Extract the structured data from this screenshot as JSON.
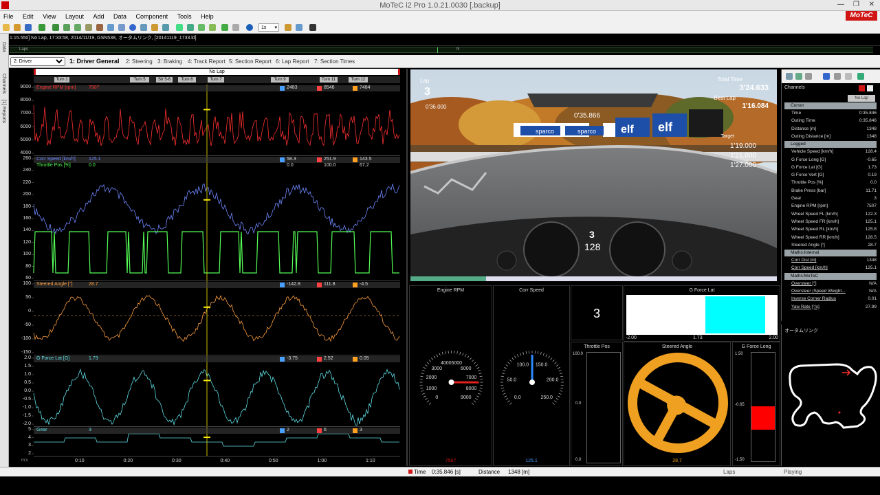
{
  "window": {
    "title": "MoTeC i2 Pro 1.0.21.0030  [.backup]"
  },
  "menu": {
    "items": [
      "File",
      "Edit",
      "View",
      "Layout",
      "Add",
      "Data",
      "Component",
      "Tools",
      "Help"
    ],
    "logo": "MoTeC"
  },
  "toolbar": {
    "zoom_value": "1x"
  },
  "lap_info": {
    "text": "1:15.550] No Lap, 17:33:58, 2014/11/19, GSN538, オータムリンク, [20141119_1733.ld]",
    "laps_label": "Laps",
    "marker": "N"
  },
  "sidebar": {
    "data_label": "Data",
    "channels_label": "Channels",
    "reports_label": "[1] Reports"
  },
  "tabs": {
    "worksheet_select": "2: Driver",
    "items": [
      "1: Driver General",
      "2: Steering",
      "3: Braking",
      "4: Track Report",
      "5: Section Report",
      "6: Lap Report",
      "7: Section Times"
    ],
    "active": 0
  },
  "graph": {
    "lap_label": "No Lap",
    "turns": [
      "Turn 1",
      "Turn 5",
      "Str 5-6",
      "Turn 6",
      "Turn 7",
      "Turn 9",
      "Turn 11",
      "Turn 12"
    ],
    "x_ticks": [
      "0:10",
      "0:20",
      "0:30",
      "0:40",
      "0:50",
      "1:00",
      "1:10"
    ],
    "x_unit": "m:s",
    "panes": [
      {
        "channels": [
          {
            "name": "Engine RPM [rpm]",
            "value": "7507",
            "color": "#ff3030"
          }
        ],
        "min": "2483",
        "max": "8546",
        "delta": "7484",
        "y_ticks": [
          "9000",
          "8000",
          "7000",
          "6000",
          "5000",
          "4000"
        ]
      },
      {
        "channels": [
          {
            "name": "Corr Speed [km/h]",
            "value": "125.1",
            "color": "#6f88ff"
          },
          {
            "name": "Throttle Pos [%]",
            "value": "0.0",
            "color": "#55ff55"
          }
        ],
        "min": "58.3",
        "max": "251.9",
        "delta": "143.5",
        "min2": "0.0",
        "max2": "100.0",
        "delta2": "67.2",
        "y_ticks": [
          "260",
          "240",
          "220",
          "200",
          "180",
          "160",
          "140",
          "120",
          "100",
          "80",
          "60"
        ]
      },
      {
        "channels": [
          {
            "name": "Steered Angle [°]",
            "value": "28.7",
            "color": "#ffa040"
          }
        ],
        "min": "-142.8",
        "max": "111.8",
        "delta": "-4.5",
        "y_ticks": [
          "100",
          "50",
          "0",
          "-50",
          "-100",
          "-150"
        ]
      },
      {
        "channels": [
          {
            "name": "G Force Lat [G]",
            "value": "1.73",
            "color": "#60e0e8"
          }
        ],
        "min": "-3.75",
        "max": "2.52",
        "delta": "0.05",
        "y_ticks": [
          "2.0",
          "1.5",
          "1.0",
          "0.5",
          "0.0",
          "-0.5",
          "-1.0",
          "-1.5",
          "-2.0"
        ]
      },
      {
        "channels": [
          {
            "name": "Gear",
            "value": "3",
            "color": "#60e0e8"
          }
        ],
        "min": "2",
        "max": "6",
        "delta": "3",
        "y_ticks": [
          "5",
          "4",
          "3",
          "2"
        ]
      }
    ]
  },
  "video": {
    "lap_label": "Lap",
    "lap_value": "3",
    "total_time_label": "Total Time",
    "total_time": "3'24.633",
    "best_lap_label": "Best Lap",
    "best_lap": "1'16.084",
    "target_label": "Target",
    "times": [
      "1'19.000",
      "1'21.000",
      "1'27.000"
    ],
    "current": "0'35.866",
    "speed": "128",
    "gear": "3",
    "hud_small": [
      "0'36.000",
      "0'35.866"
    ]
  },
  "gauges": {
    "engine_rpm": {
      "label": "Engine RPM",
      "ticks": [
        "0",
        "1000",
        "2000",
        "3000",
        "4000",
        "5000",
        "6000",
        "7000",
        "8000",
        "9000"
      ],
      "value": "7507"
    },
    "corr_speed": {
      "label": "Corr Speed",
      "ticks": [
        "0.0",
        "50.0",
        "100.0",
        "150.0",
        "200.0",
        "250.0"
      ],
      "value": "125.1"
    },
    "gear": {
      "value": "3"
    },
    "g_force_lat": {
      "label": "G Force Lat",
      "min": "-2.00",
      "max": "2.00",
      "value": "1.73"
    },
    "throttle_pos": {
      "label": "Throttle Pos",
      "ticks": [
        "100.0",
        "0.0",
        "0.0"
      ]
    },
    "steered_angle": {
      "label": "Steered Angle",
      "value": "28.7"
    },
    "g_force_long": {
      "label": "G Force Long",
      "ticks": [
        "1.50",
        "-0.65",
        "-1.50"
      ]
    }
  },
  "channels": {
    "header": "Channels",
    "filter": "No Lap",
    "sections": [
      {
        "name": "Cursor",
        "rows": [
          [
            "Time",
            "0:35.846"
          ],
          [
            "Outing Time",
            "0:35.846"
          ],
          [
            "Distance [m]",
            "1348"
          ],
          [
            "Outing Distance [m]",
            "1348"
          ]
        ]
      },
      {
        "name": "Logged",
        "rows": [
          [
            "Vehicle Speed [km/h]",
            "128.4"
          ],
          [
            "G Force Long [G]",
            "-0.65"
          ],
          [
            "G Force Lat [G]",
            "1.73"
          ],
          [
            "G Force Vert [G]",
            "0.19"
          ],
          [
            "Throttle Pos [%]",
            "0.0"
          ],
          [
            "Brake Press [bar]",
            "11.71"
          ],
          [
            "Gear",
            "3"
          ],
          [
            "Engine RPM [rpm]",
            "7507"
          ],
          [
            "Wheel Speed FL [km/h]",
            "122.3"
          ],
          [
            "Wheel Speed FR [km/h]",
            "125.1"
          ],
          [
            "Wheel Speed RL [km/h]",
            "125.8"
          ],
          [
            "Wheel Speed RR [km/h]",
            "128.5"
          ],
          [
            "Steered Angle [°]",
            "28.7"
          ]
        ]
      },
      {
        "name": "Maths:Internal",
        "rows": [
          [
            "Corr Dist [m]",
            "1348"
          ],
          [
            "Corr Speed [km/h]",
            "125.1"
          ]
        ]
      },
      {
        "name": "Maths:MoTeC",
        "rows": [
          [
            "Oversteer [°]",
            "N/A"
          ],
          [
            "Oversteer (Speed Weight...",
            "N/A"
          ],
          [
            "Inverse Corner Radius",
            "0.01"
          ],
          [
            "Yaw Rate [°/s]",
            "27.99"
          ]
        ]
      }
    ]
  },
  "track_map": {
    "title": "オータムリンク"
  },
  "status": {
    "time_label": "Time",
    "time_value": "0:35.846 [s]",
    "distance_label": "Distance",
    "distance_value": "1348 [m]",
    "laps": "Laps",
    "state": "Playing"
  },
  "colors": {
    "accent": "#d01515",
    "rpm": "#ff3030",
    "speed": "#6f88ff",
    "throttle": "#55ff55",
    "steer": "#ffa040",
    "glat": "#60e0e8",
    "cursor": "#ffee00"
  }
}
